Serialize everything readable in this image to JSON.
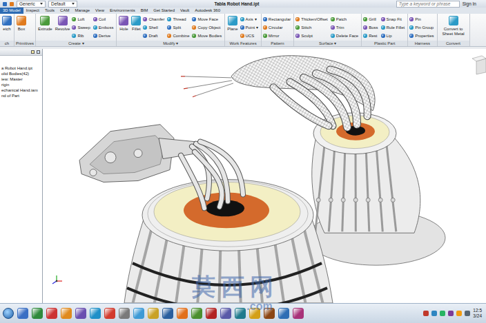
{
  "titlebar": {
    "style": "Generic",
    "appearance": "Default",
    "title": "Tabla Robot Hand.ipt",
    "search": {
      "placeholder": "Type a keyword or phrase"
    },
    "sign_in": "Sign In"
  },
  "tabs": [
    {
      "label": "3D Model",
      "selected": true
    },
    {
      "label": "Inspect",
      "selected": false
    },
    {
      "label": "Tools",
      "selected": false
    },
    {
      "label": "CAM",
      "selected": false
    },
    {
      "label": "Manage",
      "selected": false
    },
    {
      "label": "View",
      "selected": false
    },
    {
      "label": "Environments",
      "selected": false
    },
    {
      "label": "BIM",
      "selected": false
    },
    {
      "label": "Get Started",
      "selected": false
    },
    {
      "label": "Vault",
      "selected": false
    },
    {
      "label": "Autodesk 360",
      "selected": false
    }
  ],
  "ribbon": {
    "groups": [
      {
        "label": "ch",
        "large": [
          "etch"
        ],
        "small": []
      },
      {
        "label": "Primitives",
        "large": [
          "Box"
        ],
        "small": []
      },
      {
        "label": "Create ▾",
        "large": [
          "Extrude",
          "Revolve"
        ],
        "small": [
          [
            "Loft",
            "Sweep",
            "Rib"
          ],
          [
            "Coil",
            "Emboss",
            "Derive"
          ]
        ]
      },
      {
        "label": "Modify ▾",
        "large": [
          "Hole",
          "Fillet"
        ],
        "small": [
          [
            "Chamfer",
            "Shell",
            "Draft"
          ],
          [
            "Thread",
            "Split",
            "Combine"
          ],
          [
            "Move Face",
            "Copy Object",
            "Move Bodies"
          ]
        ]
      },
      {
        "label": "Work Features",
        "large": [
          "Plane"
        ],
        "small": [
          [
            "Axis ▾",
            "Point ▾",
            "UCS"
          ]
        ]
      },
      {
        "label": "Pattern",
        "large": [],
        "small": [
          [
            "Rectangular",
            "Circular",
            "Mirror"
          ]
        ]
      },
      {
        "label": "Surface ▾",
        "large": [],
        "small": [
          [
            "Thicken/Offset",
            "Stitch",
            "Sculpt"
          ],
          [
            "Patch",
            "Trim",
            "Delete Face"
          ]
        ]
      },
      {
        "label": "Plastic Part",
        "large": [],
        "small": [
          [
            "Grill",
            "Boss",
            "Rest"
          ],
          [
            "Snap Fit",
            "Rule Fillet",
            "Lip"
          ]
        ]
      },
      {
        "label": "Harness",
        "large": [],
        "small": [
          [
            "Pin",
            "Pin Group",
            "Properties"
          ]
        ]
      },
      {
        "label": "Convert",
        "large": [
          "Convert to Sheet Metal"
        ],
        "small": []
      }
    ]
  },
  "browser": {
    "items": [
      "a Robot Hand.ipt",
      "olid Bodies(42)",
      "iew: Master",
      "rigin",
      "echanical Hand.iam",
      "nd of Part"
    ]
  },
  "watermark": {
    "text": "莫西网",
    "domain": ".com"
  },
  "taskbar": {
    "apps": [
      {
        "color": "#3a6fc4"
      },
      {
        "color": "#2f8a3c"
      },
      {
        "color": "#cc3333"
      },
      {
        "color": "#e08a1e"
      },
      {
        "color": "#6a4fb0"
      },
      {
        "color": "#1e90c8"
      },
      {
        "color": "#d23b2e"
      },
      {
        "color": "#7a7a7a"
      },
      {
        "color": "#3c9ad6"
      },
      {
        "color": "#c9a227"
      },
      {
        "color": "#2a5f9e"
      },
      {
        "color": "#e2701c"
      },
      {
        "color": "#4b8f2e"
      },
      {
        "color": "#b22222"
      },
      {
        "color": "#5a5aa8"
      },
      {
        "color": "#1f7a8c"
      },
      {
        "color": "#d4a017"
      },
      {
        "color": "#8b4513"
      },
      {
        "color": "#2e6db4"
      },
      {
        "color": "#a83279"
      }
    ],
    "tray": [
      {
        "color": "#c0392b"
      },
      {
        "color": "#2e86c1"
      },
      {
        "color": "#28b463"
      },
      {
        "color": "#7d3c98"
      },
      {
        "color": "#f39c12"
      },
      {
        "color": "#566573"
      }
    ],
    "clock": {
      "time": "12:5",
      "date": "3/24"
    }
  }
}
